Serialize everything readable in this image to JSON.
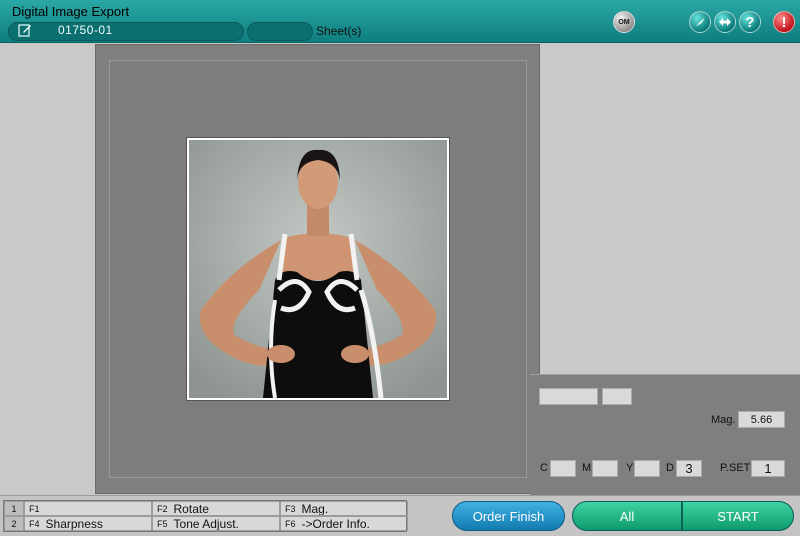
{
  "window": {
    "title": "Digital Image Export"
  },
  "order": {
    "number": "01750-01",
    "sheets_value": "",
    "sheets_label": "Sheet(s)"
  },
  "header_buttons": {
    "om_label": "OM",
    "help_label": "?",
    "alert_label": "!"
  },
  "info": {
    "mag_label": "Mag.",
    "mag_value": "5.66",
    "c_label": "C",
    "c_value": "",
    "m_label": "M",
    "m_value": "",
    "y_label": "Y",
    "y_value": "",
    "d_label": "D",
    "d_value": "3",
    "pset_label": "P.SET",
    "pset_value": "1"
  },
  "fkeys": {
    "row1": "1",
    "row2": "2",
    "f1_key": "F1",
    "f1_label": "",
    "f2_key": "F2",
    "f2_label": "Rotate",
    "f3_key": "F3",
    "f3_label": "Mag.",
    "f4_key": "F4",
    "f4_label": "Sharpness",
    "f5_key": "F5",
    "f5_label": "Tone Adjust.",
    "f6_key": "F6",
    "f6_label": "->Order Info."
  },
  "actions": {
    "order_finish": "Order Finish",
    "all": "All",
    "start": "START"
  },
  "colors": {
    "titlebar": "#1a9492",
    "panel": "#7f7f7f",
    "button_green": "#1cb282",
    "button_blue": "#1f8fc6",
    "alert": "#d0161f"
  }
}
